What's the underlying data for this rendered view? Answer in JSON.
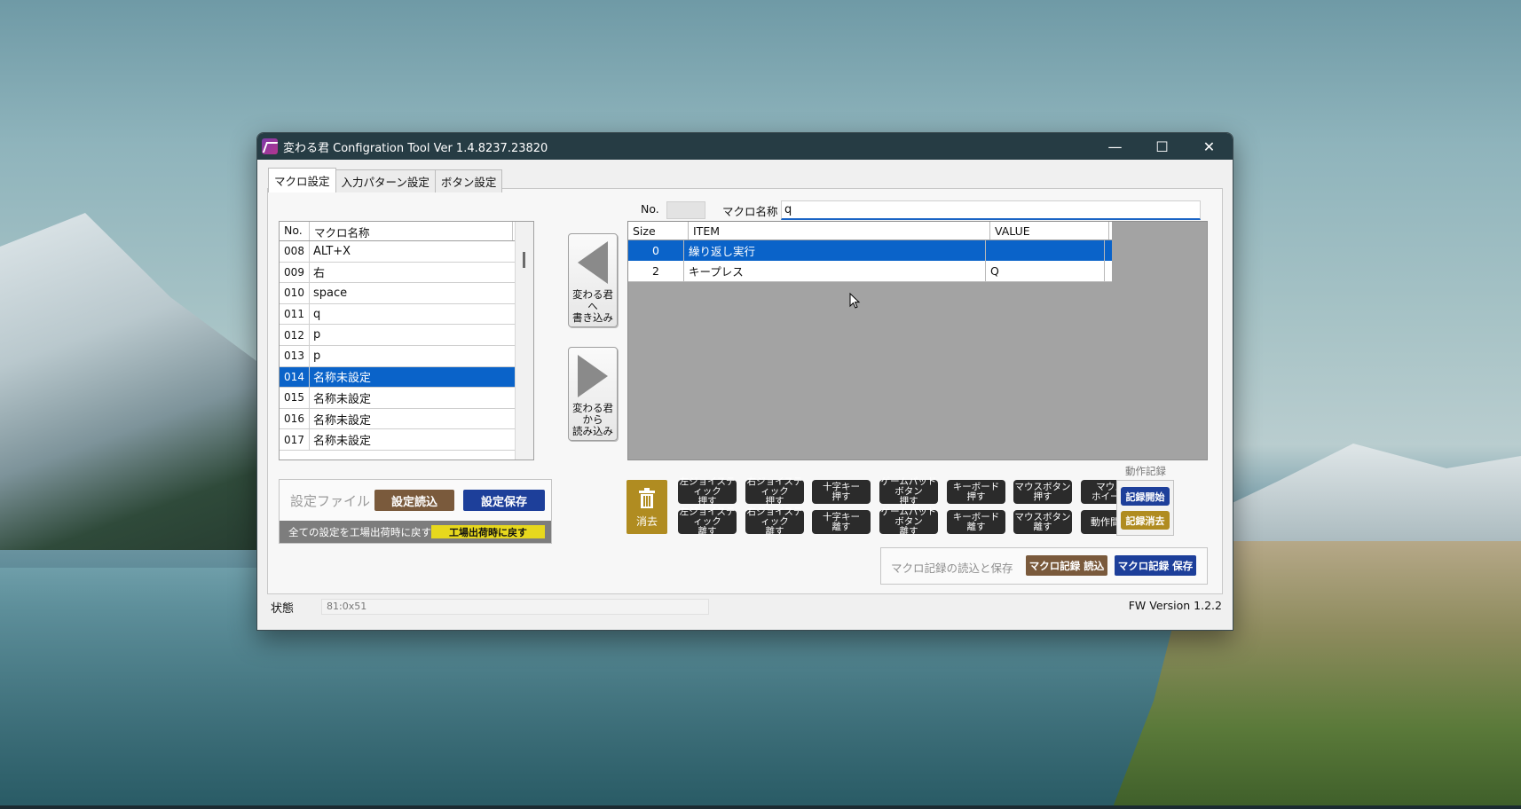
{
  "window": {
    "title": "変わる君 Configration Tool Ver 1.4.8237.23820",
    "controls": {
      "minimize": "—",
      "maximize": "☐",
      "close": "✕"
    }
  },
  "tabs": [
    {
      "label": "マクロ設定",
      "active": true
    },
    {
      "label": "入力パターン設定",
      "active": false
    },
    {
      "label": "ボタン設定",
      "active": false
    }
  ],
  "macro_list": {
    "columns": [
      "No.",
      "マクロ名称"
    ],
    "rows": [
      {
        "no": "008",
        "name": "ALT+X"
      },
      {
        "no": "009",
        "name": "右"
      },
      {
        "no": "010",
        "name": "space"
      },
      {
        "no": "011",
        "name": "q"
      },
      {
        "no": "012",
        "name": "p"
      },
      {
        "no": "013",
        "name": "p"
      },
      {
        "no": "014",
        "name": "名称未設定",
        "selected": true
      },
      {
        "no": "015",
        "name": "名称未設定"
      },
      {
        "no": "016",
        "name": "名称未設定"
      },
      {
        "no": "017",
        "name": "名称未設定"
      }
    ]
  },
  "transfer": {
    "write_label": "変わる君\nへ\n書き込み",
    "read_label": "変わる君\nから\n読み込み"
  },
  "fields": {
    "no_label": "No.",
    "no_value": "",
    "name_label": "マクロ名称",
    "name_value": "q"
  },
  "item_grid": {
    "columns": [
      "Size",
      "ITEM",
      "VALUE"
    ],
    "rows": [
      {
        "size": "0",
        "item": "繰り返し実行",
        "value": "",
        "selected": true
      },
      {
        "size": "2",
        "item": "キープレス",
        "value": "Q"
      }
    ]
  },
  "settings_file": {
    "label": "設定ファイル",
    "load_label": "設定読込",
    "save_label": "設定保存",
    "reset_text": "全ての設定を工場出荷時に戻す",
    "reset_button": "工場出荷時に戻す"
  },
  "actions": {
    "delete_label": "消去",
    "buttons_top": [
      {
        "l1": "左ジョイスティック",
        "l2": "押す"
      },
      {
        "l1": "右ジョイスティック",
        "l2": "押す"
      },
      {
        "l1": "十字キー",
        "l2": "押す"
      },
      {
        "l1": "ゲームパッドボタン",
        "l2": "押す"
      },
      {
        "l1": "キーボード",
        "l2": "押す"
      },
      {
        "l1": "マウスボタン",
        "l2": "押す"
      },
      {
        "l1": "マウス",
        "l2": "ホイール"
      }
    ],
    "buttons_bottom": [
      {
        "l1": "左ジョイスティック",
        "l2": "離す"
      },
      {
        "l1": "右ジョイスティック",
        "l2": "離す"
      },
      {
        "l1": "十字キー",
        "l2": "離す"
      },
      {
        "l1": "ゲームパッドボタン",
        "l2": "離す"
      },
      {
        "l1": "キーボード",
        "l2": "離す"
      },
      {
        "l1": "マウスボタン",
        "l2": "離す"
      },
      {
        "l1": "動作間隔",
        "l2": ""
      }
    ]
  },
  "recording": {
    "label": "動作記録",
    "start_label": "記録開始",
    "clear_label": "記録消去"
  },
  "macro_file": {
    "label": "マクロ記録の読込と保存",
    "load_label": "マクロ記録 読込",
    "save_label": "マクロ記録 保存"
  },
  "status": {
    "label": "状態",
    "value": "81:0x51",
    "fw_version": "FW Version 1.2.2"
  },
  "colors": {
    "titlebar": "#263c44",
    "selection": "#0a63c9",
    "brown_button": "#7a5a3c",
    "navy_button": "#1d3f9a",
    "gold_button": "#b08c21",
    "reset_yellow": "#e7d81d"
  }
}
